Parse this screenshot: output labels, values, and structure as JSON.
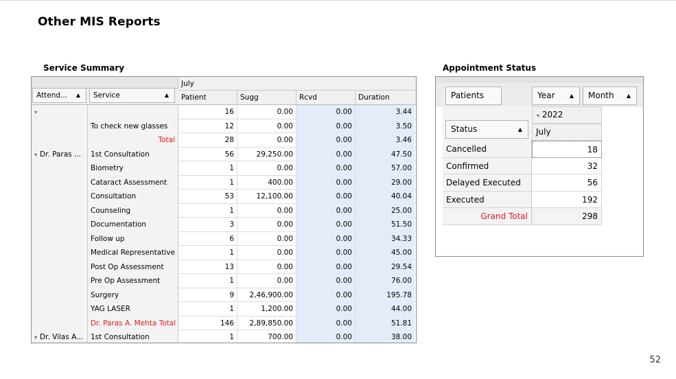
{
  "page": {
    "title": "Other MIS Reports",
    "page_number": "52"
  },
  "service_summary": {
    "title": "Service Summary",
    "month": "July",
    "field_attending": "Attend...",
    "field_service": "Service",
    "columns": [
      "Patient",
      "Sugg",
      "Rcvd",
      "Duration"
    ],
    "rows": [
      {
        "attending": "",
        "attending_collapse": "⌄",
        "service": "",
        "patient": "16",
        "sugg": "0.00",
        "rcvd": "0.00",
        "duration": "3.44"
      },
      {
        "attending": "",
        "service": "To check new glasses",
        "patient": "12",
        "sugg": "0.00",
        "rcvd": "0.00",
        "duration": "3.50"
      },
      {
        "attending": "",
        "service": "Total",
        "total": true,
        "patient": "28",
        "sugg": "0.00",
        "rcvd": "0.00",
        "duration": "3.46"
      },
      {
        "attending": "Dr. Paras ...",
        "attending_collapse": "⌄",
        "service": "1st Consultation",
        "patient": "56",
        "sugg": "29,250.00",
        "rcvd": "0.00",
        "duration": "47.50"
      },
      {
        "attending": "",
        "service": "Biometry",
        "patient": "1",
        "sugg": "0.00",
        "rcvd": "0.00",
        "duration": "57.00"
      },
      {
        "attending": "",
        "service": "Cataract Assessment",
        "patient": "1",
        "sugg": "400.00",
        "rcvd": "0.00",
        "duration": "29.00"
      },
      {
        "attending": "",
        "service": "Consultation",
        "patient": "53",
        "sugg": "12,100.00",
        "rcvd": "0.00",
        "duration": "40.04"
      },
      {
        "attending": "",
        "service": "Counseling",
        "patient": "1",
        "sugg": "0.00",
        "rcvd": "0.00",
        "duration": "25.00"
      },
      {
        "attending": "",
        "service": "Documentation",
        "patient": "3",
        "sugg": "0.00",
        "rcvd": "0.00",
        "duration": "51.50"
      },
      {
        "attending": "",
        "service": "Follow up",
        "patient": "6",
        "sugg": "0.00",
        "rcvd": "0.00",
        "duration": "34.33"
      },
      {
        "attending": "",
        "service": "Medical Representative",
        "patient": "1",
        "sugg": "0.00",
        "rcvd": "0.00",
        "duration": "45.00"
      },
      {
        "attending": "",
        "service": "Post Op Assessment",
        "patient": "13",
        "sugg": "0.00",
        "rcvd": "0.00",
        "duration": "29.54"
      },
      {
        "attending": "",
        "service": "Pre Op Assessment",
        "patient": "1",
        "sugg": "0.00",
        "rcvd": "0.00",
        "duration": "76.00"
      },
      {
        "attending": "",
        "service": "Surgery",
        "patient": "9",
        "sugg": "2,46,900.00",
        "rcvd": "0.00",
        "duration": "195.78"
      },
      {
        "attending": "",
        "service": "YAG LASER",
        "patient": "1",
        "sugg": "1,200.00",
        "rcvd": "0.00",
        "duration": "44.00"
      },
      {
        "attending": "",
        "service": "Dr. Paras A. Mehta Total",
        "total": true,
        "patient": "146",
        "sugg": "2,89,850.00",
        "rcvd": "0.00",
        "duration": "51.81"
      },
      {
        "attending": "Dr. Vilas A...",
        "attending_collapse": "⌄",
        "service": "1st Consultation",
        "patient": "1",
        "sugg": "700.00",
        "rcvd": "0.00",
        "duration": "38.00"
      }
    ]
  },
  "appointment_status": {
    "title": "Appointment Status",
    "field_patients": "Patients",
    "field_year": "Year",
    "field_month": "Month",
    "field_status": "Status",
    "year": "2022",
    "month": "July",
    "rows": [
      {
        "label": "Cancelled",
        "value": "18"
      },
      {
        "label": "Confirmed",
        "value": "32"
      },
      {
        "label": "Delayed Executed",
        "value": "56"
      },
      {
        "label": "Executed",
        "value": "192"
      }
    ],
    "grand_total_label": "Grand Total",
    "grand_total_value": "298"
  },
  "colors": {
    "total_text": "#e0201c",
    "highlight_column": "#e4ecfa"
  }
}
